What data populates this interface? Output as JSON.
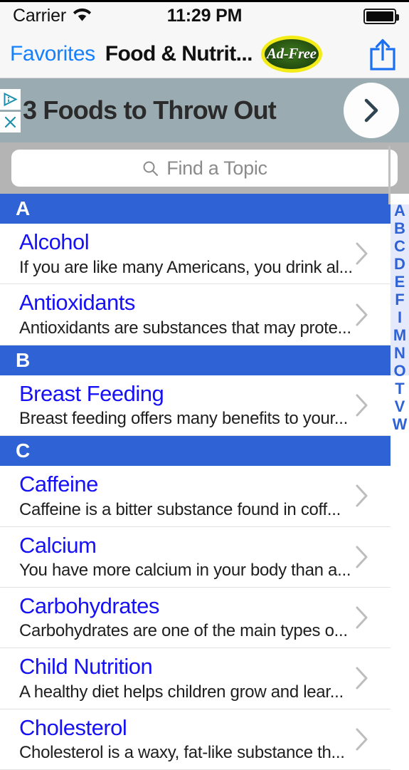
{
  "status_bar": {
    "carrier": "Carrier",
    "wifi_icon": "wifi-icon",
    "time": "11:29 PM",
    "battery_icon": "battery-full-icon"
  },
  "nav_bar": {
    "back_label": "Favorites",
    "title": "Food & Nutrit...",
    "ad_free_badge": "Ad-Free",
    "share_icon": "share-icon"
  },
  "ad_banner": {
    "headline": "3 Foods to Throw Out",
    "adchoices_icon": "adchoices-icon",
    "close_icon": "close-icon",
    "cta_icon": "chevron-right-icon",
    "background_color": "#9aabb2"
  },
  "search": {
    "placeholder": "Find a Topic",
    "icon": "search-icon"
  },
  "list": {
    "section_color": "#2f62d4",
    "title_color": "#1711f5",
    "sections": [
      {
        "letter": "A",
        "items": [
          {
            "title": "Alcohol",
            "desc": "If you are like many Americans, you drink al..."
          },
          {
            "title": "Antioxidants",
            "desc": "Antioxidants are substances that may prote..."
          }
        ]
      },
      {
        "letter": "B",
        "items": [
          {
            "title": "Breast Feeding",
            "desc": "Breast feeding offers many benefits to your..."
          }
        ]
      },
      {
        "letter": "C",
        "items": [
          {
            "title": "Caffeine",
            "desc": "Caffeine is a bitter substance found in coff..."
          },
          {
            "title": "Calcium",
            "desc": "You have more calcium in your body than a..."
          },
          {
            "title": "Carbohydrates",
            "desc": "Carbohydrates are one of the main types o..."
          },
          {
            "title": "Child Nutrition",
            "desc": "A healthy diet helps children grow and lear..."
          },
          {
            "title": "Cholesterol",
            "desc": "Cholesterol is a waxy, fat-like substance th..."
          }
        ]
      }
    ]
  },
  "index_bar": {
    "letters": [
      "A",
      "B",
      "C",
      "D",
      "E",
      "F",
      "I",
      "M",
      "N",
      "O",
      "T",
      "V",
      "W"
    ]
  }
}
